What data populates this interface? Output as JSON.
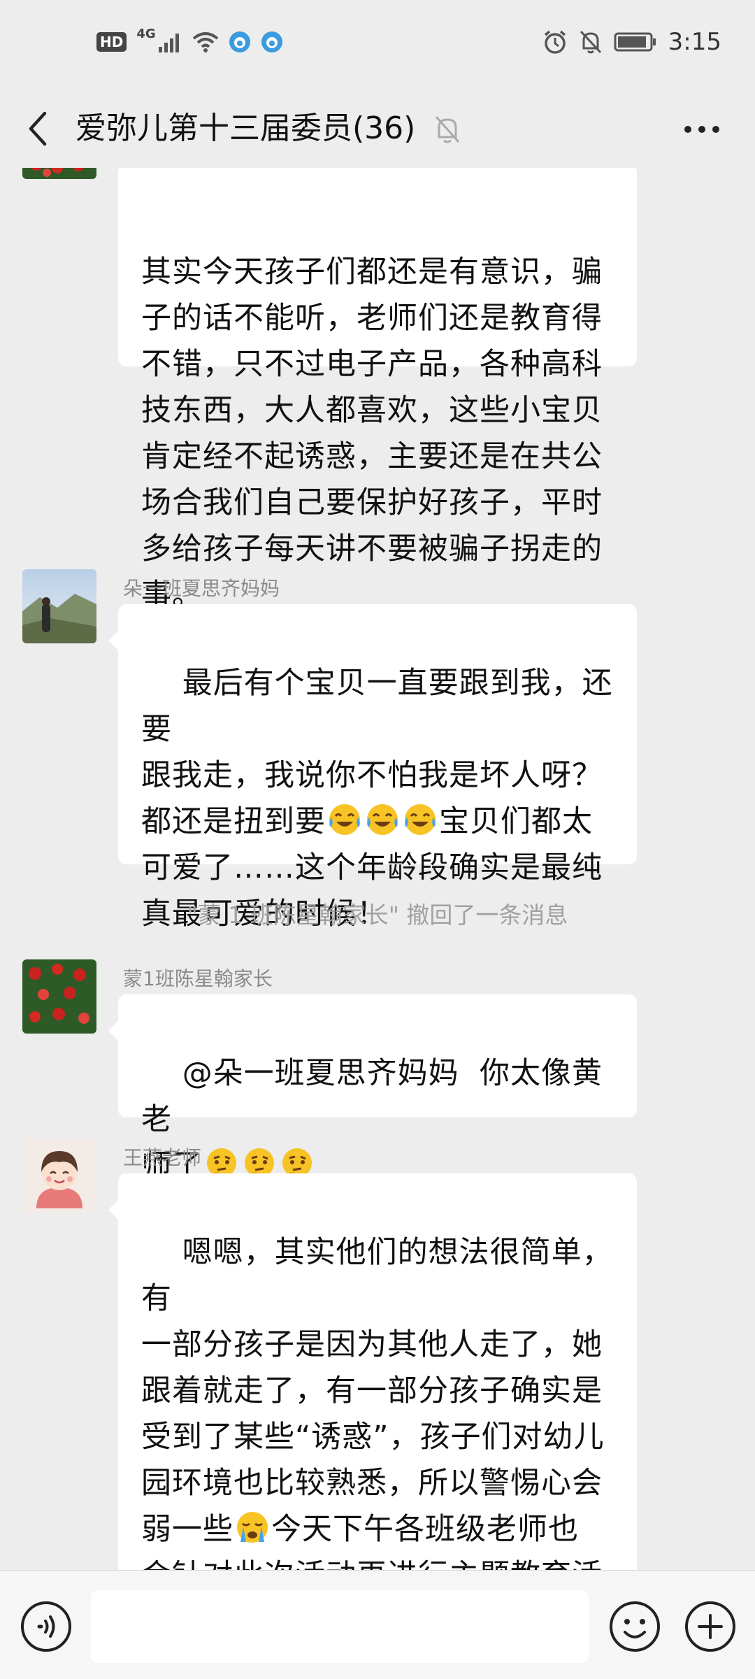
{
  "status_bar": {
    "hd_badge": "HD",
    "network_label": "4G",
    "time": "3:15",
    "icons": [
      "hd-badge",
      "signal-icon",
      "wifi-icon",
      "app-notify-icon",
      "app-notify-icon",
      "alarm-icon",
      "mute-icon",
      "battery-icon"
    ]
  },
  "header": {
    "title": "爱弥儿第十三届委员(36)",
    "icons": [
      "back-icon",
      "mute-bell-icon",
      "more-icon"
    ]
  },
  "messages": [
    {
      "sender": "",
      "text": "其实今天孩子们都还是有意识，骗\n子的话不能听，老师们还是教育得\n不错，只不过电子产品，各种高科\n技东西，大人都喜欢，这些小宝贝\n肯定经不起诱惑，主要还是在共公\n场合我们自己要保护好孩子，平时\n多给孩子每天讲不要被骗子拐走的\n事。"
    },
    {
      "sender": "朵一班夏思齐妈妈",
      "text_a": "最后有个宝贝一直要跟到我，还要\n跟我走，我说你不怕我是坏人呀？\n都还是扭到要",
      "text_b": "宝贝们都太\n可爱了……这个年龄段确实是最纯\n真最可爱的时候！"
    },
    {
      "sender": "蒙1班陈星翰家长",
      "text_a": "@朵一班夏思齐妈妈  你太像黄老\n师了"
    },
    {
      "sender": "王燕老师",
      "text_a": "嗯嗯，其实他们的想法很简单，有\n一部分孩子是因为其他人走了，她\n跟着就走了，有一部分孩子确实是\n受到了某些“诱惑”，孩子们对幼儿\n园环境也比较熟悉，所以警惕心会\n弱一些",
      "text_b": "今天下午各班级老师也\n会针对此次活动再进行主题教育活\n动，打铁趁热的让孩子们增强自我\n保护意识"
    }
  ],
  "recall_notice": "\"蒙 1 班陈星翰家长\" 撤回了一条消息",
  "input_bar": {
    "input_value": "",
    "icons": [
      "voice-icon",
      "emoji-icon",
      "plus-icon"
    ]
  },
  "colors": {
    "background": "#ededed",
    "bubble": "#ffffff",
    "secondary_text": "#8a8a8a"
  }
}
